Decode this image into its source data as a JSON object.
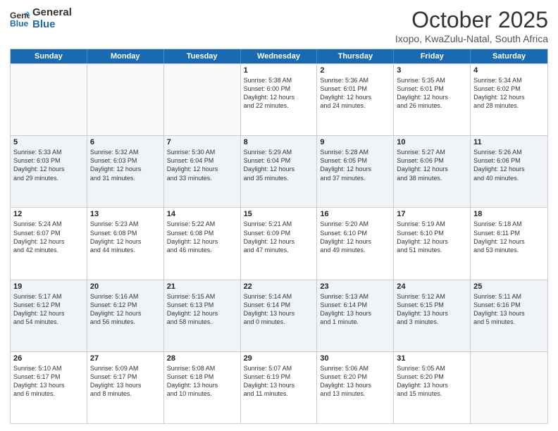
{
  "header": {
    "logo_line1": "General",
    "logo_line2": "Blue",
    "month_title": "October 2025",
    "location": "Ixopo, KwaZulu-Natal, South Africa"
  },
  "weekdays": [
    "Sunday",
    "Monday",
    "Tuesday",
    "Wednesday",
    "Thursday",
    "Friday",
    "Saturday"
  ],
  "rows": [
    [
      {
        "day": "",
        "text": ""
      },
      {
        "day": "",
        "text": ""
      },
      {
        "day": "",
        "text": ""
      },
      {
        "day": "1",
        "text": "Sunrise: 5:38 AM\nSunset: 6:00 PM\nDaylight: 12 hours\nand 22 minutes."
      },
      {
        "day": "2",
        "text": "Sunrise: 5:36 AM\nSunset: 6:01 PM\nDaylight: 12 hours\nand 24 minutes."
      },
      {
        "day": "3",
        "text": "Sunrise: 5:35 AM\nSunset: 6:01 PM\nDaylight: 12 hours\nand 26 minutes."
      },
      {
        "day": "4",
        "text": "Sunrise: 5:34 AM\nSunset: 6:02 PM\nDaylight: 12 hours\nand 28 minutes."
      }
    ],
    [
      {
        "day": "5",
        "text": "Sunrise: 5:33 AM\nSunset: 6:03 PM\nDaylight: 12 hours\nand 29 minutes."
      },
      {
        "day": "6",
        "text": "Sunrise: 5:32 AM\nSunset: 6:03 PM\nDaylight: 12 hours\nand 31 minutes."
      },
      {
        "day": "7",
        "text": "Sunrise: 5:30 AM\nSunset: 6:04 PM\nDaylight: 12 hours\nand 33 minutes."
      },
      {
        "day": "8",
        "text": "Sunrise: 5:29 AM\nSunset: 6:04 PM\nDaylight: 12 hours\nand 35 minutes."
      },
      {
        "day": "9",
        "text": "Sunrise: 5:28 AM\nSunset: 6:05 PM\nDaylight: 12 hours\nand 37 minutes."
      },
      {
        "day": "10",
        "text": "Sunrise: 5:27 AM\nSunset: 6:06 PM\nDaylight: 12 hours\nand 38 minutes."
      },
      {
        "day": "11",
        "text": "Sunrise: 5:26 AM\nSunset: 6:06 PM\nDaylight: 12 hours\nand 40 minutes."
      }
    ],
    [
      {
        "day": "12",
        "text": "Sunrise: 5:24 AM\nSunset: 6:07 PM\nDaylight: 12 hours\nand 42 minutes."
      },
      {
        "day": "13",
        "text": "Sunrise: 5:23 AM\nSunset: 6:08 PM\nDaylight: 12 hours\nand 44 minutes."
      },
      {
        "day": "14",
        "text": "Sunrise: 5:22 AM\nSunset: 6:08 PM\nDaylight: 12 hours\nand 46 minutes."
      },
      {
        "day": "15",
        "text": "Sunrise: 5:21 AM\nSunset: 6:09 PM\nDaylight: 12 hours\nand 47 minutes."
      },
      {
        "day": "16",
        "text": "Sunrise: 5:20 AM\nSunset: 6:10 PM\nDaylight: 12 hours\nand 49 minutes."
      },
      {
        "day": "17",
        "text": "Sunrise: 5:19 AM\nSunset: 6:10 PM\nDaylight: 12 hours\nand 51 minutes."
      },
      {
        "day": "18",
        "text": "Sunrise: 5:18 AM\nSunset: 6:11 PM\nDaylight: 12 hours\nand 53 minutes."
      }
    ],
    [
      {
        "day": "19",
        "text": "Sunrise: 5:17 AM\nSunset: 6:12 PM\nDaylight: 12 hours\nand 54 minutes."
      },
      {
        "day": "20",
        "text": "Sunrise: 5:16 AM\nSunset: 6:12 PM\nDaylight: 12 hours\nand 56 minutes."
      },
      {
        "day": "21",
        "text": "Sunrise: 5:15 AM\nSunset: 6:13 PM\nDaylight: 12 hours\nand 58 minutes."
      },
      {
        "day": "22",
        "text": "Sunrise: 5:14 AM\nSunset: 6:14 PM\nDaylight: 13 hours\nand 0 minutes."
      },
      {
        "day": "23",
        "text": "Sunrise: 5:13 AM\nSunset: 6:14 PM\nDaylight: 13 hours\nand 1 minute."
      },
      {
        "day": "24",
        "text": "Sunrise: 5:12 AM\nSunset: 6:15 PM\nDaylight: 13 hours\nand 3 minutes."
      },
      {
        "day": "25",
        "text": "Sunrise: 5:11 AM\nSunset: 6:16 PM\nDaylight: 13 hours\nand 5 minutes."
      }
    ],
    [
      {
        "day": "26",
        "text": "Sunrise: 5:10 AM\nSunset: 6:17 PM\nDaylight: 13 hours\nand 6 minutes."
      },
      {
        "day": "27",
        "text": "Sunrise: 5:09 AM\nSunset: 6:17 PM\nDaylight: 13 hours\nand 8 minutes."
      },
      {
        "day": "28",
        "text": "Sunrise: 5:08 AM\nSunset: 6:18 PM\nDaylight: 13 hours\nand 10 minutes."
      },
      {
        "day": "29",
        "text": "Sunrise: 5:07 AM\nSunset: 6:19 PM\nDaylight: 13 hours\nand 11 minutes."
      },
      {
        "day": "30",
        "text": "Sunrise: 5:06 AM\nSunset: 6:20 PM\nDaylight: 13 hours\nand 13 minutes."
      },
      {
        "day": "31",
        "text": "Sunrise: 5:05 AM\nSunset: 6:20 PM\nDaylight: 13 hours\nand 15 minutes."
      },
      {
        "day": "",
        "text": ""
      }
    ]
  ]
}
